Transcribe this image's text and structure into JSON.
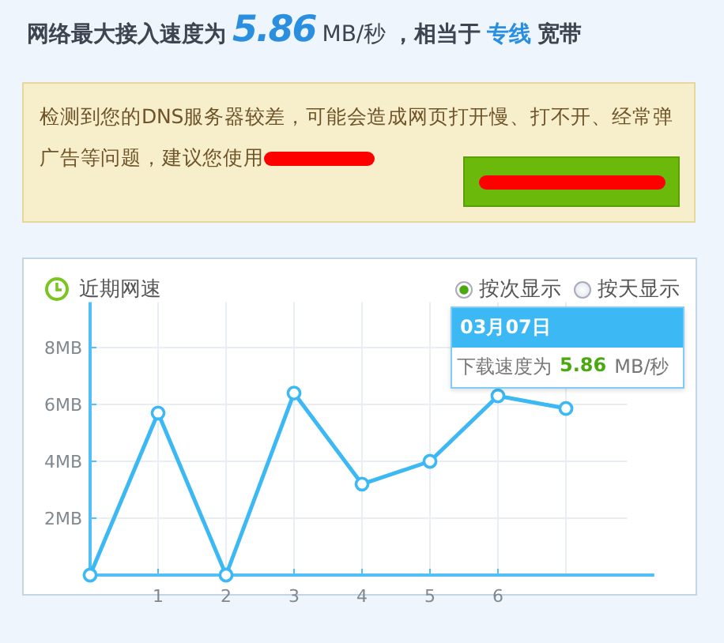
{
  "headline": {
    "prefix": "网络最大接入速度为",
    "speed": "5.86",
    "unit": "MB/秒",
    "middle": "，相当于",
    "line_type": "专线",
    "suffix": "宽带"
  },
  "notice": {
    "text": "检测到您的DNS服务器较差，可能会造成网页打开慢、打不开、经常弹广告等问题，建议您使用",
    "redacted": true,
    "button": {
      "redacted": true
    }
  },
  "speed_panel": {
    "title": "近期网速",
    "modes": [
      {
        "label": "按次显示",
        "selected": true
      },
      {
        "label": "按天显示",
        "selected": false
      }
    ],
    "tooltip": {
      "date": "03月07日",
      "label": "下载速度为",
      "value": "5.86",
      "unit": "MB/秒"
    },
    "chart_data": {
      "type": "line",
      "x": [
        0,
        1,
        2,
        3,
        4,
        5,
        6,
        7
      ],
      "grid": true,
      "series": [
        {
          "color": "#3cb8f5",
          "marker": "circle",
          "values": [
            0,
            5.7,
            0,
            6.4,
            3.2,
            4.0,
            6.3,
            5.86
          ]
        }
      ],
      "xlim": [
        0,
        8.3
      ],
      "ylim": [
        0,
        9.6
      ],
      "xticks": [
        1,
        2,
        3,
        4,
        5,
        6
      ],
      "yticks": [
        {
          "value": 2,
          "label": "2MB"
        },
        {
          "value": 4,
          "label": "4MB"
        },
        {
          "value": 6,
          "label": "6MB"
        },
        {
          "value": 8,
          "label": "8MB"
        }
      ]
    }
  }
}
